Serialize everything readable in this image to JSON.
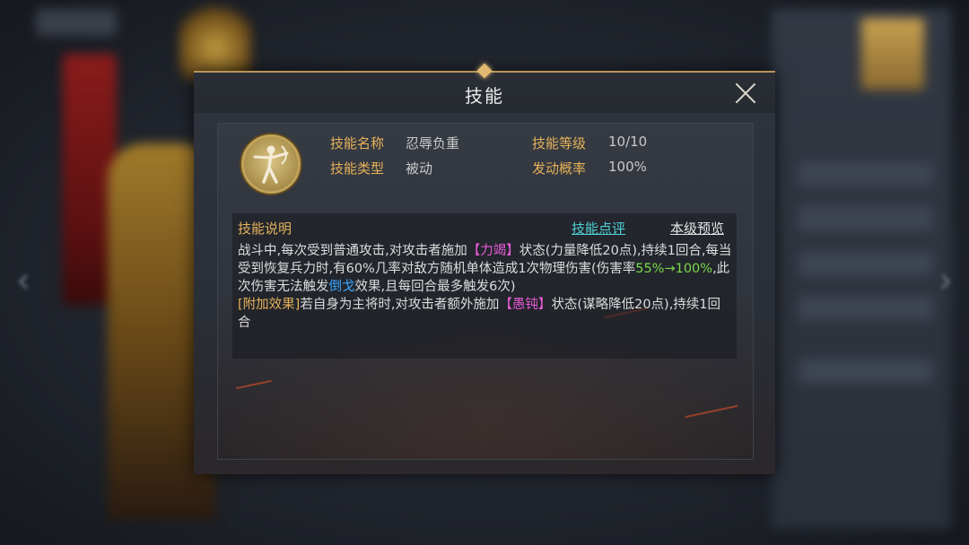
{
  "dialog": {
    "title": "技能"
  },
  "skill": {
    "icon": "archer-figure-icon",
    "name_label": "技能名称",
    "name_value": "忍辱负重",
    "level_label": "技能等级",
    "level_value": "10/10",
    "type_label": "技能类型",
    "type_value": "被动",
    "rate_label": "发动概率",
    "rate_value": "100%"
  },
  "description": {
    "heading": "技能说明",
    "review_link": "技能点评",
    "preview_link": "本级预览",
    "p1_a": "战斗中,每次受到普通攻击,对攻击者施加",
    "p1_b": "【力竭】",
    "p1_c": "状态(力量降低20点),持续1回合,每当受到恢复兵力时,有60%几率对敌方随机单体造成1次物理伤害(伤害率",
    "p1_d": "55%→100%",
    "p1_e": ",此次伤害无法触发",
    "p1_f": "倒戈",
    "p1_g": "效果,且每回合最多触发6次)",
    "p2_a": "[附加效果]",
    "p2_b": "若自身为主将时,对攻击者额外施加",
    "p2_c": "【愚钝】",
    "p2_d": "状态(谋略降低20点),持续1回合"
  },
  "colors": {
    "accent_gold": "#e6b25a",
    "link_cyan": "#4fd1d6",
    "status_purple": "#e85ad8",
    "value_green": "#7ad84a",
    "keyword_blue": "#3ba7ff"
  }
}
